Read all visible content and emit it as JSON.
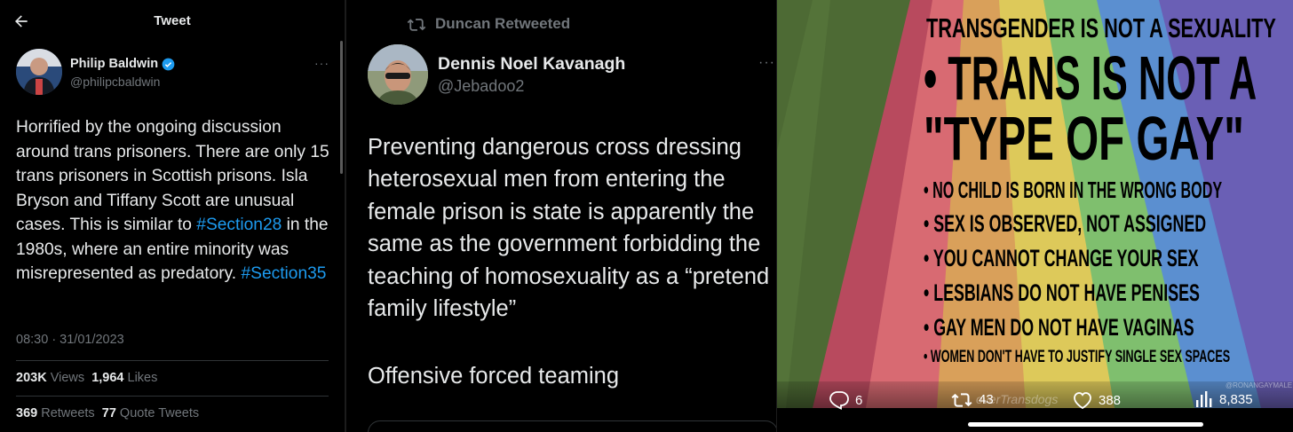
{
  "left_tweet": {
    "header_title": "Tweet",
    "author_name": "Philip Baldwin",
    "author_handle": "@philipcbaldwin",
    "text_part1": "Horrified by the ongoing discussion around trans prisoners. There are only 15 trans prisoners in Scottish prisons. Isla Bryson and Tiffany Scott are unusual cases. This is similar to ",
    "hashtag1": "#Section28",
    "text_part2": " in the 1980s, where an entire minority was misrepresented as predatory. ",
    "hashtag2": "#Section35",
    "timestamp": "08:30 · 31/01/2023",
    "views_count": "203K",
    "views_label": "Views",
    "likes_count": "1,964",
    "likes_label": "Likes",
    "retweets_count": "369",
    "retweets_label": "Retweets",
    "quotes_count": "77",
    "quotes_label": "Quote Tweets",
    "more_label": "···"
  },
  "middle_tweet": {
    "retweeted_by": "Duncan Retweeted",
    "author_name": "Dennis Noel Kavanagh",
    "author_handle": "@Jebadoo2",
    "text": "Preventing dangerous cross dressing heterosexual men from entering the female prison is state is apparently the same as the government forbidding the teaching of homosexuality as a “pretend family lifestyle”",
    "comment": "Offensive forced teaming",
    "more_label": "···"
  },
  "image_post": {
    "meme_lines": [
      "TRANSGENDER IS NOT A SEXUALITY",
      "• TRANS IS NOT A",
      "\"TYPE OF GAY\"",
      "• NO CHILD IS BORN IN THE WRONG BODY",
      "• SEX IS OBSERVED, NOT ASSIGNED",
      "• YOU CANNOT CHANGE YOUR SEX",
      "• LESBIANS DO NOT HAVE PENISES",
      "• GAY MEN DO NOT HAVE VAGINAS",
      "• WOMEN DON'T HAVE TO JUSTIFY SINGLE SEX SPACES"
    ],
    "watermark": "overTransdogs",
    "watermark_corner": "@RONANGAYMALE",
    "replies": "6",
    "retweets": "43",
    "likes": "388",
    "views": "8,835"
  },
  "icons": [
    "back-arrow-icon",
    "verified-badge-icon",
    "retweet-icon",
    "reply-icon",
    "like-icon",
    "views-icon"
  ],
  "colors": {
    "link": "#1d9bf0",
    "muted": "#71767b",
    "text": "#e7e9ea",
    "background": "#000000"
  }
}
